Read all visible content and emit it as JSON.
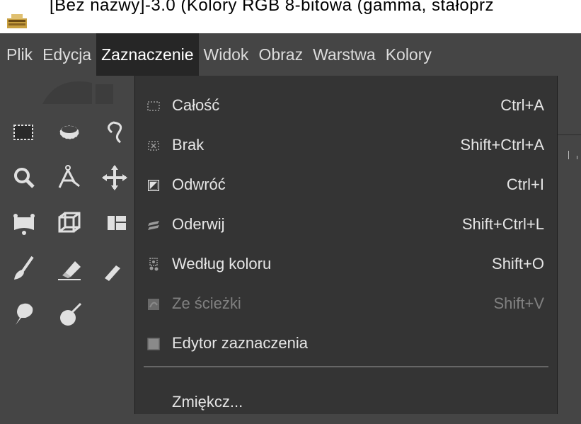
{
  "window": {
    "title": "[Bez nazwy]-3.0 (Kolory RGB 8-bitowa (gamma, stałoprz"
  },
  "menubar": {
    "items": [
      "Plik",
      "Edycja",
      "Zaznaczenie",
      "Widok",
      "Obraz",
      "Warstwa",
      "Kolory"
    ],
    "active": "Zaznaczenie"
  },
  "toolbox": {
    "tools": [
      "rect-select-icon",
      "ellipse-select-icon",
      "free-select-icon",
      "zoom-icon",
      "measure-icon",
      "move-icon",
      "unified-transform-icon",
      "perspective-icon",
      "align-icon",
      "paintbrush-icon",
      "eraser-icon",
      "airbrush-icon",
      "smudge-icon",
      "dodge-icon"
    ]
  },
  "select_menu": {
    "items": [
      {
        "label": "Całość",
        "shortcut": "Ctrl+A",
        "icon": "select-all-icon",
        "enabled": true
      },
      {
        "label": "Brak",
        "shortcut": "Shift+Ctrl+A",
        "icon": "select-none-icon",
        "enabled": true
      },
      {
        "label": "Odwróć",
        "shortcut": "Ctrl+I",
        "icon": "invert-selection-icon",
        "enabled": true
      },
      {
        "label": "Oderwij",
        "shortcut": "Shift+Ctrl+L",
        "icon": "float-selection-icon",
        "enabled": true
      },
      {
        "label": "Według koloru",
        "shortcut": "Shift+O",
        "icon": "select-by-color-icon",
        "enabled": true
      },
      {
        "label": "Ze ścieżki",
        "shortcut": "Shift+V",
        "icon": "path-to-selection-icon",
        "enabled": false
      },
      {
        "label": "Edytor zaznaczenia",
        "shortcut": "",
        "icon": "selection-editor-icon",
        "enabled": true
      }
    ],
    "after_separator": [
      {
        "label": "Zmiękcz...",
        "shortcut": "",
        "enabled": true
      }
    ]
  }
}
